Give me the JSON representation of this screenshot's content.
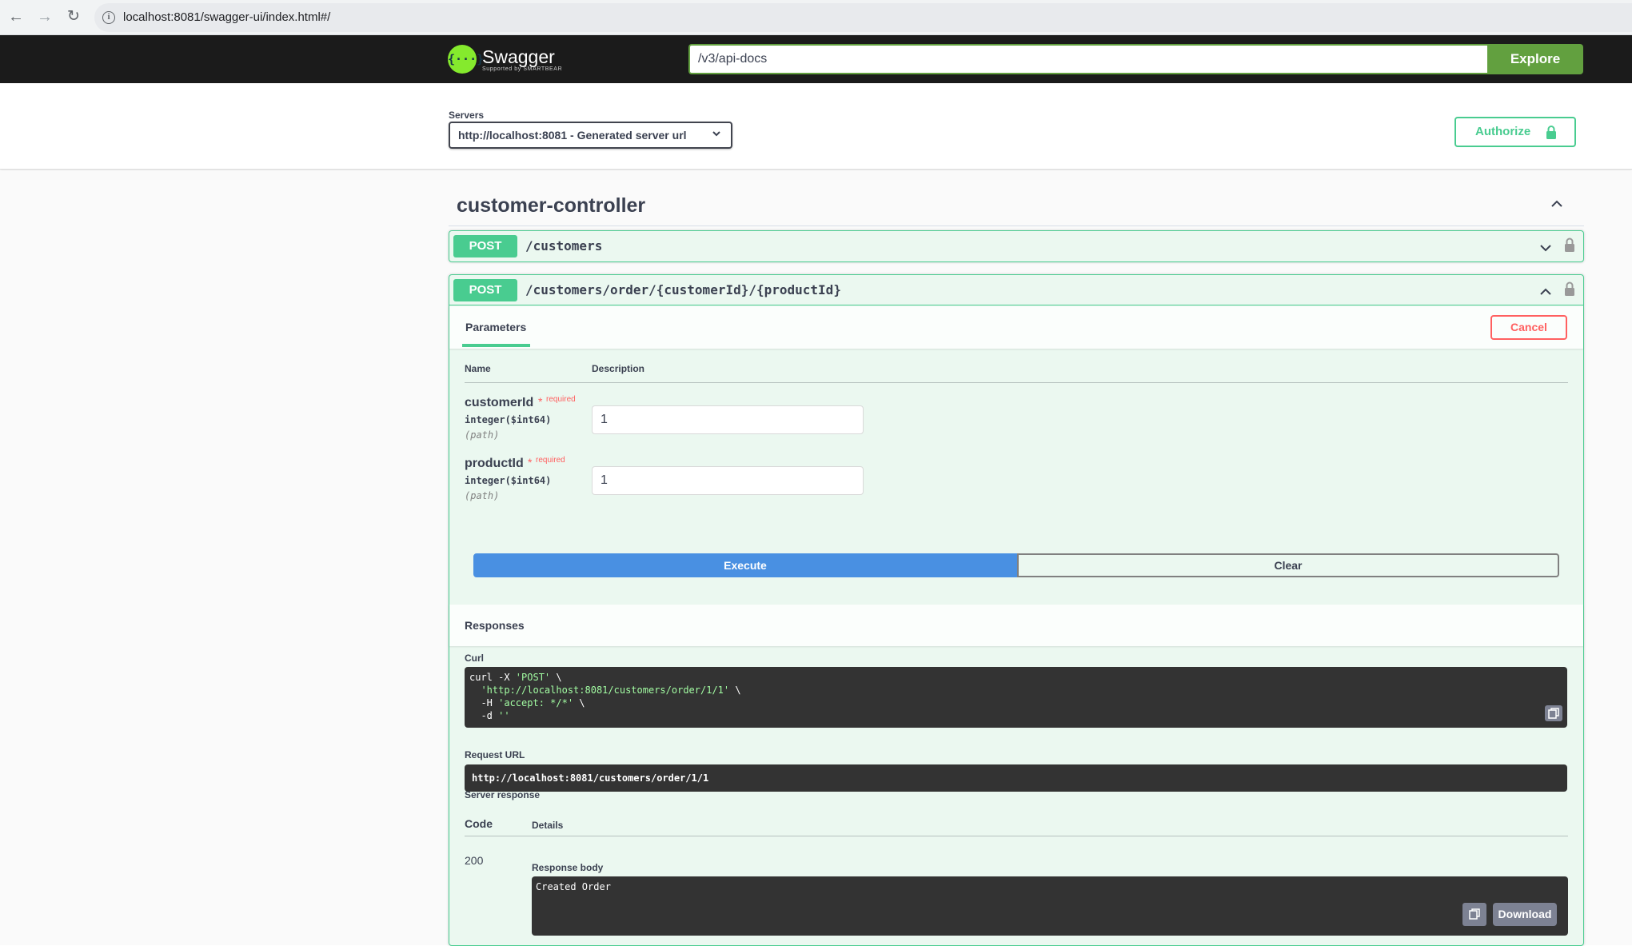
{
  "browser": {
    "url": "localhost:8081/swagger-ui/index.html#/"
  },
  "topbar": {
    "logo_name": "Swagger",
    "logo_sub": "Supported by SMARTBEAR",
    "spec_url": "/v3/api-docs",
    "explore_label": "Explore"
  },
  "servers": {
    "label": "Servers",
    "selected": "http://localhost:8081 - Generated server url",
    "authorize_label": "Authorize"
  },
  "tag": {
    "title": "customer-controller"
  },
  "operations": [
    {
      "method": "POST",
      "path": "/customers"
    },
    {
      "method": "POST",
      "path": "/customers/order/{customerId}/{productId}"
    }
  ],
  "params": {
    "tab_label": "Parameters",
    "cancel_label": "Cancel",
    "col_name": "Name",
    "col_description": "Description",
    "items": [
      {
        "name": "customerId",
        "required_label": "required",
        "type": "integer($int64)",
        "in": "(path)",
        "value": "1"
      },
      {
        "name": "productId",
        "required_label": "required",
        "type": "integer($int64)",
        "in": "(path)",
        "value": "1"
      }
    ],
    "execute_label": "Execute",
    "clear_label": "Clear"
  },
  "responses": {
    "title": "Responses",
    "curl_label": "Curl",
    "curl": {
      "l1_a": "curl -X ",
      "l1_b": "'POST'",
      "l1_c": " \\",
      "l2_a": "  ",
      "l2_b": "'http://localhost:8081/customers/order/1/1'",
      "l2_c": " \\",
      "l3_a": "  -H ",
      "l3_b": "'accept: */*'",
      "l3_c": " \\",
      "l4_a": "  -d ",
      "l4_b": "''"
    },
    "request_url_label": "Request URL",
    "request_url": "http://localhost:8081/customers/order/1/1",
    "server_response_label": "Server response",
    "col_code": "Code",
    "col_details": "Details",
    "code": "200",
    "response_body_label": "Response body",
    "response_body": "Created Order",
    "download_label": "Download"
  },
  "colors": {
    "post_green": "#49cc90",
    "topbar_bg": "#1b1b1b",
    "explore_green": "#62a03f",
    "execute_blue": "#4990e2",
    "cancel_red": "#ff6060"
  }
}
